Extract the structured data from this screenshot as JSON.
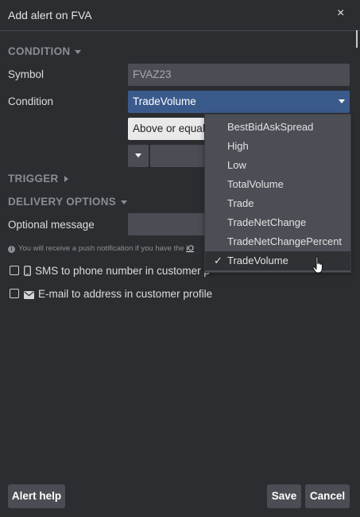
{
  "dialog": {
    "title": "Add alert on FVA",
    "close_glyph": "×"
  },
  "condition_section": {
    "heading": "CONDITION"
  },
  "symbol": {
    "label": "Symbol",
    "value": "FVAZ23"
  },
  "condition": {
    "label": "Condition",
    "value": "TradeVolume"
  },
  "operator": {
    "value": "Above or equal"
  },
  "trigger_section": {
    "heading": "TRIGGER"
  },
  "delivery_section": {
    "heading": "DELIVERY OPTIONS"
  },
  "message": {
    "label": "Optional message",
    "value": ""
  },
  "note": {
    "text": "You will receive a push notification if you have the ",
    "link": "iO"
  },
  "sms": {
    "label": "SMS to phone number in customer p",
    "checked": false
  },
  "email": {
    "label": "E-mail to address in customer profile",
    "checked": false
  },
  "dropdown": {
    "items": [
      {
        "label": "BestBidAskSpread"
      },
      {
        "label": "High"
      },
      {
        "label": "Low"
      },
      {
        "label": "TotalVolume"
      },
      {
        "label": "Trade"
      },
      {
        "label": "TradeNetChange"
      },
      {
        "label": "TradeNetChangePercent"
      },
      {
        "label": "TradeVolume",
        "selected": true
      }
    ],
    "checkmark": "✓"
  },
  "buttons": {
    "help": "Alert help",
    "save": "Save",
    "cancel": "Cancel"
  },
  "colors": {
    "background": "#2b2d31",
    "field": "#4a4d53",
    "selected_field": "#3b5a8c",
    "dropdown": "#4b4e55"
  }
}
